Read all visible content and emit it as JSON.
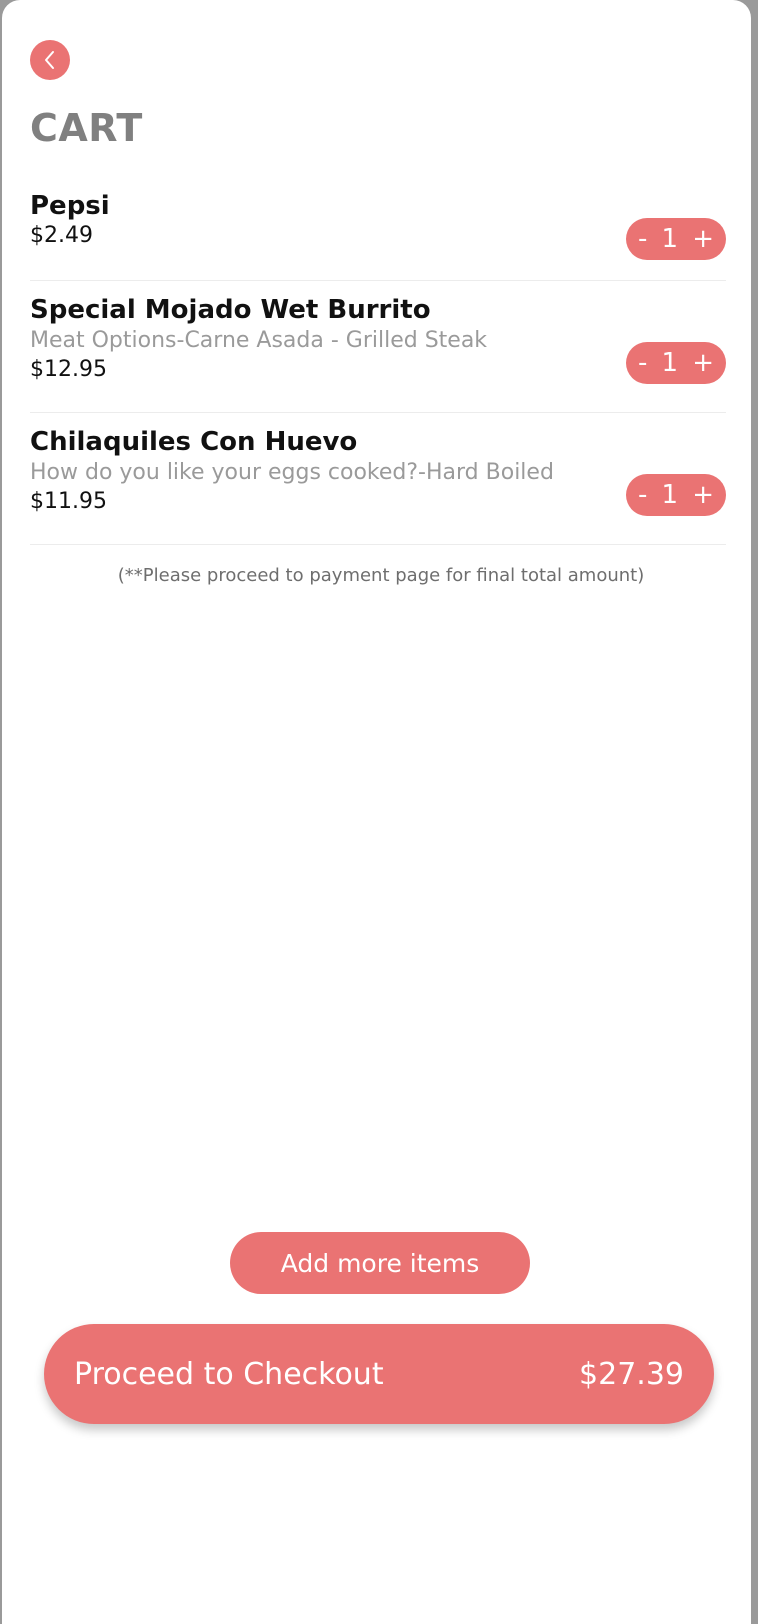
{
  "header": {
    "back_icon": "chevron-left-icon",
    "title": "CART"
  },
  "colors": {
    "accent": "#ea7373",
    "title_gray": "#808080",
    "option_gray": "#9a9a9a"
  },
  "cart": {
    "items": [
      {
        "name": "Pepsi",
        "option": "",
        "price": "$2.49",
        "qty_minus": "-",
        "quantity": "1",
        "qty_plus": "+"
      },
      {
        "name": "Special Mojado Wet Burrito",
        "option": "Meat Options-Carne Asada - Grilled Steak",
        "price": "$12.95",
        "qty_minus": "-",
        "quantity": "1",
        "qty_plus": "+"
      },
      {
        "name": "Chilaquiles Con Huevo",
        "option": "How do you like your eggs cooked?-Hard Boiled",
        "price": "$11.95",
        "qty_minus": "-",
        "quantity": "1",
        "qty_plus": "+"
      }
    ],
    "note": "(**Please proceed to payment page for final total amount)"
  },
  "actions": {
    "add_more_label": "Add more items",
    "checkout_label": "Proceed to Checkout",
    "checkout_total": "$27.39"
  }
}
